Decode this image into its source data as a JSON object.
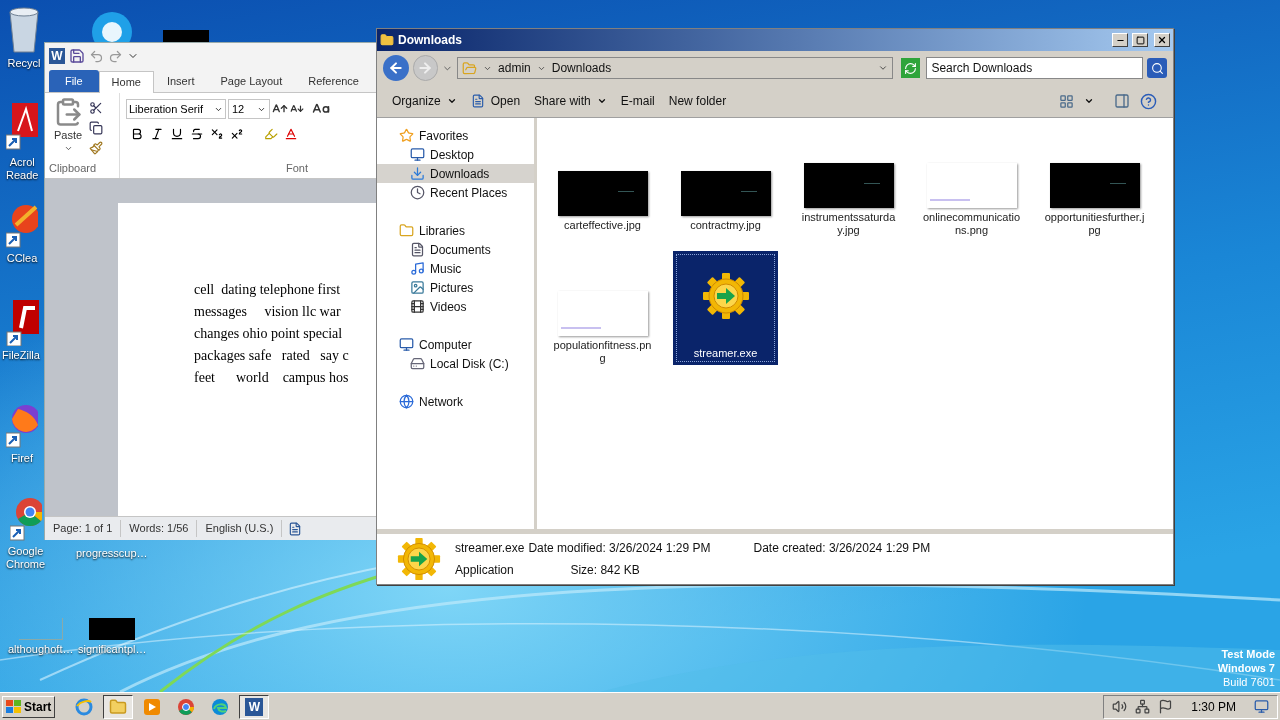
{
  "desktop": {
    "icons": [
      {
        "kind": "recycle",
        "lines": [
          "Recycl"
        ]
      },
      {
        "kind": "skype"
      },
      {
        "kind": "dark-file"
      },
      {
        "kind": "acrobat",
        "lines": [
          "Acrol",
          "Reade"
        ]
      },
      {
        "kind": "ccleaner",
        "lines": [
          "CClea"
        ]
      },
      {
        "kind": "filezilla",
        "lines": [
          "FileZilla"
        ]
      },
      {
        "kind": "firefox",
        "lines": [
          "Firef"
        ]
      },
      {
        "kind": "chrome",
        "lines": [
          "Google",
          "Chrome"
        ]
      },
      {
        "kind": "hidden",
        "lines": [
          "progresscup…"
        ]
      },
      {
        "kind": "light-file",
        "lines": [
          "althoughoft…"
        ]
      },
      {
        "kind": "dark-file",
        "lines": [
          "significantpl…"
        ]
      }
    ],
    "watermark_text": [
      "Test Mode",
      "Windows 7",
      "Build 7601"
    ]
  },
  "word": {
    "logo": "W",
    "tabs": [
      {
        "label": "File",
        "kind": "file",
        "selected": false
      },
      {
        "label": "Home",
        "kind": "tab",
        "selected": true
      },
      {
        "label": "Insert",
        "kind": "tab",
        "selected": false
      },
      {
        "label": "Page Layout",
        "kind": "tab",
        "selected": false
      },
      {
        "label": "Reference",
        "kind": "tab",
        "selected": false
      }
    ],
    "paste_label": "Paste",
    "clipboard_label": "Clipboard",
    "font_name": "Liberation Serif",
    "font_size": "12",
    "font_label": "Font",
    "document_lines": [
      "cell  dating telephone first",
      "messages     vision llc war",
      "changes ohio point special",
      "packages safe   rated   say c",
      "feet      world    campus hos"
    ],
    "status": [
      "Page: 1 of 1",
      "Words: 1/56",
      "English (U.S.)"
    ]
  },
  "explorer": {
    "title": "Downloads",
    "path": [
      "admin",
      "Downloads"
    ],
    "search": {
      "placeholder": "Search Downloads"
    },
    "toolbar": [
      {
        "label": "Organize",
        "kind": "menu"
      },
      {
        "label": "Open",
        "kind": "open"
      },
      {
        "label": "Share with",
        "kind": "menu"
      },
      {
        "label": "E-mail",
        "kind": "plain"
      },
      {
        "label": "New folder",
        "kind": "plain"
      }
    ],
    "nav": [
      {
        "label": "Favorites",
        "kind": "favorites",
        "selected": false,
        "children": [
          {
            "label": "Desktop",
            "kind": "desktop",
            "selected": false
          },
          {
            "label": "Downloads",
            "kind": "downloads",
            "selected": true
          },
          {
            "label": "Recent Places",
            "kind": "recent",
            "selected": false
          }
        ]
      },
      {
        "label": "Libraries",
        "kind": "libraries",
        "selected": false,
        "children": [
          {
            "label": "Documents",
            "kind": "documents",
            "selected": false
          },
          {
            "label": "Music",
            "kind": "music",
            "selected": false
          },
          {
            "label": "Pictures",
            "kind": "pictures",
            "selected": false
          },
          {
            "label": "Videos",
            "kind": "videos",
            "selected": false
          }
        ]
      },
      {
        "label": "Computer",
        "kind": "computer",
        "selected": false,
        "children": [
          {
            "label": "Local Disk (C:)",
            "kind": "disk",
            "selected": false
          }
        ]
      },
      {
        "label": "Network",
        "kind": "network",
        "selected": false
      }
    ],
    "files": [
      {
        "name": "carteffective.jpg",
        "kind": "dark-image",
        "selected": false
      },
      {
        "name": "contractmy.jpg",
        "kind": "dark-image",
        "selected": false
      },
      {
        "name": "instrumentssaturday.jpg",
        "kind": "dark-image",
        "selected": false
      },
      {
        "name": "onlinecommunications.png",
        "kind": "light-image",
        "selected": false
      },
      {
        "name": "opportunitiesfurther.jpg",
        "kind": "dark-image",
        "selected": false
      },
      {
        "name": "populationfitness.png",
        "kind": "light-image",
        "selected": false
      },
      {
        "name": "streamer.exe",
        "kind": "application",
        "selected": true
      }
    ],
    "details": {
      "name": "streamer.exe",
      "type": "Application",
      "fields": [
        {
          "label": "Date modified:",
          "value": "3/26/2024 1:29 PM"
        },
        {
          "label": "Date created:",
          "value": "3/26/2024 1:29 PM"
        },
        {
          "label": "Size:",
          "value": "842 KB"
        }
      ]
    }
  },
  "taskbar": {
    "start": "Start",
    "apps": [
      {
        "kind": "ie",
        "selected": false
      },
      {
        "kind": "explorer",
        "selected": true
      },
      {
        "kind": "media",
        "selected": false
      },
      {
        "kind": "chrome",
        "selected": false
      },
      {
        "kind": "edge",
        "selected": false
      },
      {
        "kind": "word",
        "label": "W",
        "selected": true
      }
    ],
    "clock": "1:30 PM"
  }
}
